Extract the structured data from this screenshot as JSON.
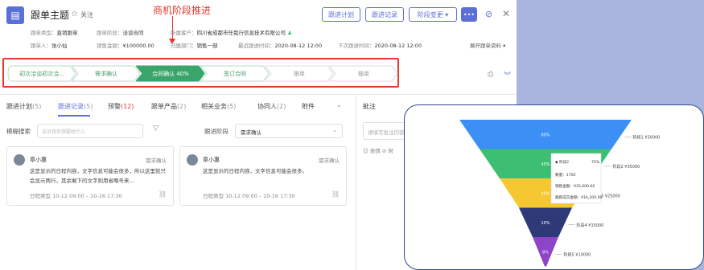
{
  "header": {
    "title": "跟单主题",
    "follow_label": "关注",
    "annotation": "商机阶段推进",
    "buttons": [
      "跟进计划",
      "跟进记录",
      "阶段变更 ▾",
      "•••"
    ],
    "meta_row1": [
      {
        "label": "跟单类型：",
        "value": "直销跟单"
      },
      {
        "label": "跟单阶段：",
        "value": "洽谈合同"
      },
      {
        "label": "所属客户：",
        "value": "四川省成都市任我行信息技术有限公司"
      }
    ],
    "meta_row2": [
      {
        "label": "跟单人：",
        "value": "张小仙"
      },
      {
        "label": "销售金额：",
        "value": "¥100000.00"
      },
      {
        "label": "归属部门：",
        "value": "销售一部"
      },
      {
        "label": "最近跟进时间：",
        "value": "2020-08-12  12:00"
      },
      {
        "label": "下次跟进时间：",
        "value": "2020-08-12  12:00"
      }
    ],
    "expand_label": "展开跟单资料 ▾"
  },
  "stages": [
    {
      "label": "初次洽谈初次洽...",
      "state": "done"
    },
    {
      "label": "需求确认",
      "state": "done"
    },
    {
      "label": "合同确认 40%",
      "state": "active"
    },
    {
      "label": "签订合同",
      "state": "next"
    },
    {
      "label": "跟单",
      "state": "future"
    },
    {
      "label": "输单",
      "state": "future"
    }
  ],
  "tabs": [
    {
      "label": "跟进计划",
      "count": "(5)"
    },
    {
      "label": "跟进记录",
      "count": "(5)"
    },
    {
      "label": "预警",
      "count": "(12)"
    },
    {
      "label": "跟单产品",
      "count": "(2)"
    },
    {
      "label": "相关业务",
      "count": "(5)"
    },
    {
      "label": "协同人",
      "count": "(2)"
    },
    {
      "label": "附件",
      "count": ""
    }
  ],
  "filters": {
    "search_label": "模糊搜索",
    "search_placeholder": "告诉我你想要啥什么",
    "stage_label": "跟进阶段",
    "stage_value": "需求确认"
  },
  "cards": [
    {
      "name": "章小惠",
      "stage": "需求确认",
      "text": "这是显示的日程内容，文字信息可能会很多，所以这里就只会显示两行，其余剩下的文字则用省略号来...",
      "footer": "日程类型   10-12 09:00 – 10-16 17:30"
    },
    {
      "name": "章小惠",
      "stage": "需求确认",
      "text": "这是显示的日程内容，文字信息可能会很多。",
      "footer": "日程类型   10-12 09:00 – 10-16 17:30"
    }
  ],
  "annotations_panel": {
    "title": "批注",
    "input_placeholder": "请填写批注内容",
    "tools": "☺ 表情   ⊘ 附"
  },
  "chart_data": {
    "type": "funnel",
    "stages": [
      {
        "label": "阶段1",
        "value_label": "¥50000",
        "percent": "80%",
        "color": "#3b8ff5"
      },
      {
        "label": "阶段2",
        "value_label": "¥35000",
        "percent": "45%",
        "color": "#3cbf73"
      },
      {
        "label": "阶段3",
        "value_label": "¥25000",
        "percent": "40%",
        "color": "#f5c832"
      },
      {
        "label": "阶段4",
        "value_label": "¥15000",
        "percent": "10%",
        "color": "#2e3a78"
      },
      {
        "label": "阶段5",
        "value_label": "¥10000",
        "percent": "8%",
        "color": "#8e44c8"
      }
    ],
    "tooltip": {
      "title": "阶段2",
      "percent": "75%",
      "rows": [
        "数量：1700",
        "销售金额：¥35,000.00",
        "跟踪成交金额：¥16,200.00"
      ]
    }
  }
}
